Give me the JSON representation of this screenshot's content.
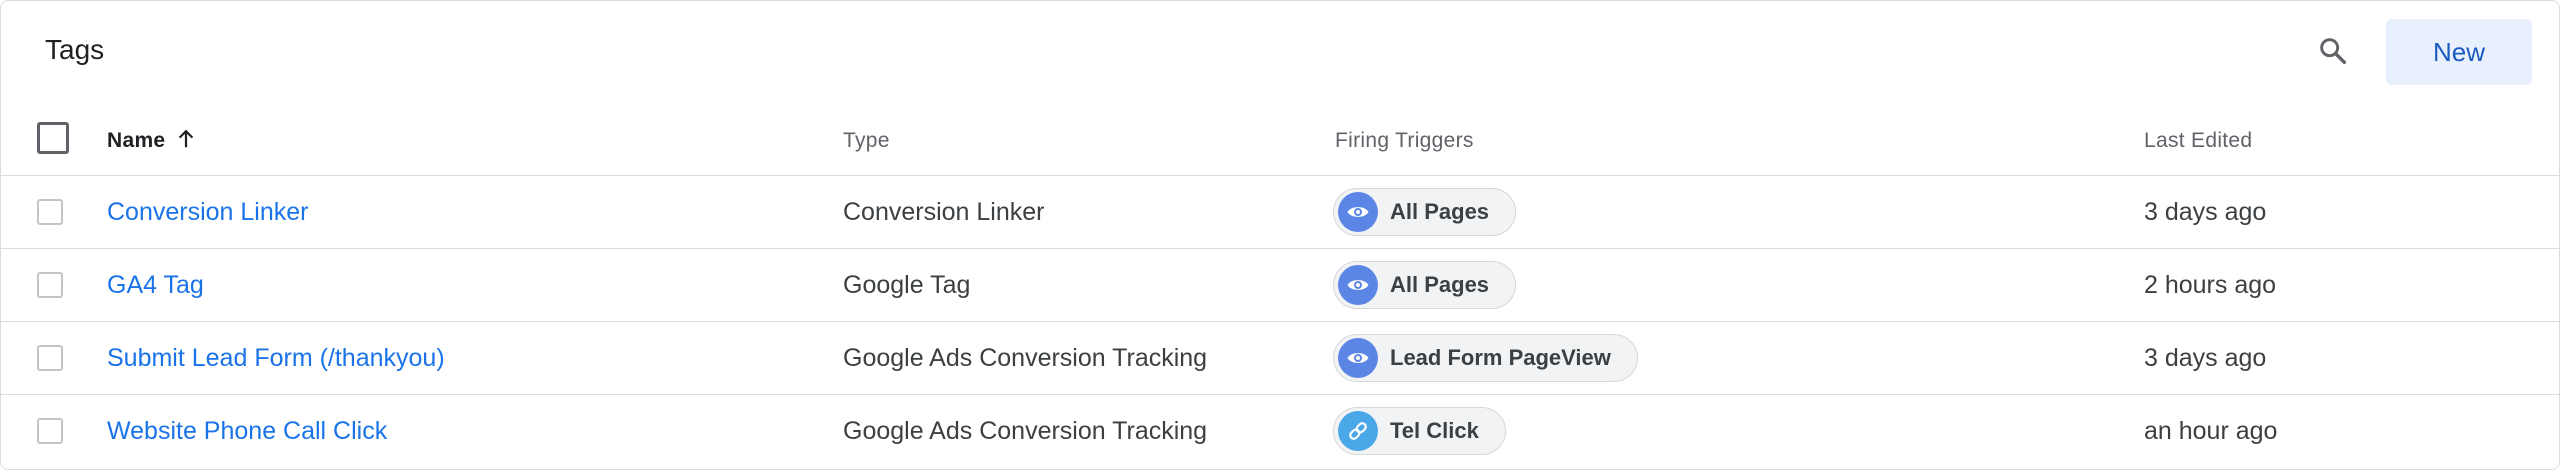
{
  "header": {
    "title": "Tags",
    "search_icon": "search-icon",
    "new_label": "New"
  },
  "table": {
    "columns": {
      "name": "Name",
      "type": "Type",
      "firing_triggers": "Firing Triggers",
      "last_edited": "Last Edited"
    },
    "sort_icon": "arrow-up-icon",
    "rows": [
      {
        "name": "Conversion Linker",
        "type": "Conversion Linker",
        "trigger": {
          "label": "All Pages",
          "icon": "eye-icon",
          "color": "#5b86e5"
        },
        "last_edited": "3 days ago"
      },
      {
        "name": "GA4 Tag",
        "type": "Google Tag",
        "trigger": {
          "label": "All Pages",
          "icon": "eye-icon",
          "color": "#5b86e5"
        },
        "last_edited": "2 hours ago"
      },
      {
        "name": "Submit Lead Form (/thankyou)",
        "type": "Google Ads Conversion Tracking",
        "trigger": {
          "label": "Lead Form PageView",
          "icon": "eye-icon",
          "color": "#5b86e5"
        },
        "last_edited": "3 days ago"
      },
      {
        "name": "Website Phone Call Click",
        "type": "Google Ads Conversion Tracking",
        "trigger": {
          "label": "Tel Click",
          "icon": "link-icon",
          "color": "#4aa8e8"
        },
        "last_edited": "an hour ago"
      }
    ]
  },
  "colors": {
    "link": "#1a73e8",
    "new_button_bg": "#e8f0fe",
    "new_button_text": "#1a5bbf",
    "divider": "#dadce0"
  }
}
